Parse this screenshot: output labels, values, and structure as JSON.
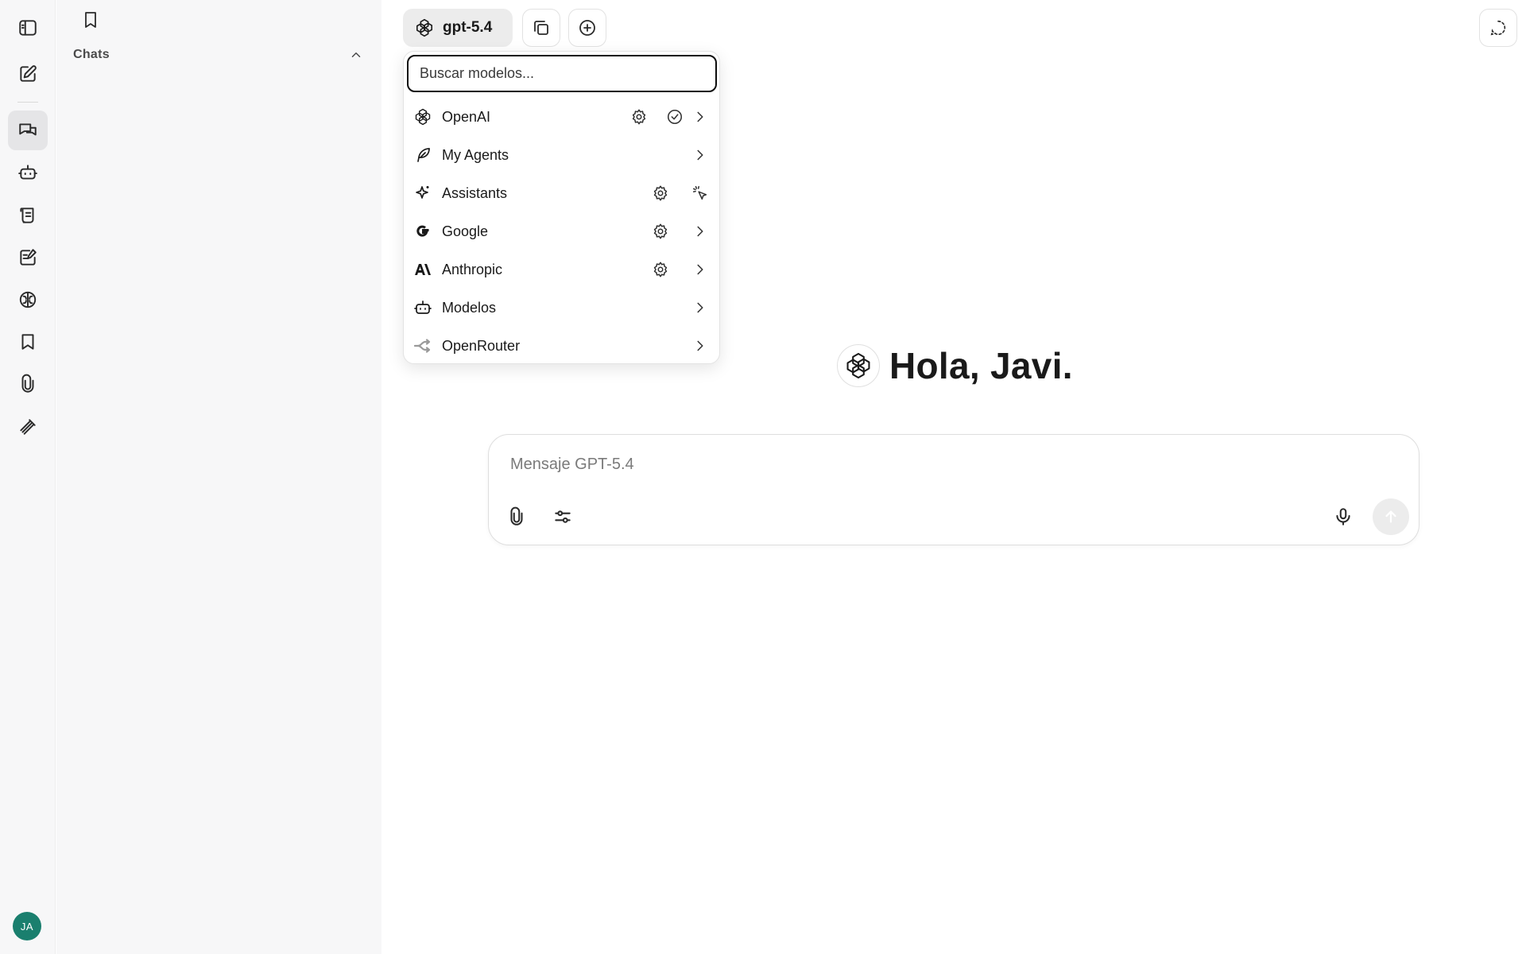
{
  "sidebar": {
    "section_title": "Chats",
    "avatar_initials": "JA"
  },
  "rail": {
    "items": [
      {
        "icon": "sidebar-toggle-icon"
      },
      {
        "icon": "new-chat-icon"
      },
      {
        "icon": "chats-icon",
        "active": true
      },
      {
        "icon": "agents-bot-icon"
      },
      {
        "icon": "prompts-icon"
      },
      {
        "icon": "memories-icon"
      },
      {
        "icon": "brain-icon"
      },
      {
        "icon": "bookmark-icon"
      },
      {
        "icon": "attachments-icon"
      },
      {
        "icon": "tools-icon"
      }
    ]
  },
  "header": {
    "model_label": "gpt-5.4"
  },
  "model_menu": {
    "search_placeholder": "Buscar modelos...",
    "items": [
      {
        "label": "OpenAI",
        "icon": "openai-icon",
        "actions": [
          "settings-icon",
          "check-circle-icon",
          "chevron-right-icon"
        ]
      },
      {
        "label": "My Agents",
        "icon": "feather-icon",
        "actions": [
          "chevron-right-icon"
        ]
      },
      {
        "label": "Assistants",
        "icon": "sparkle-icon",
        "actions": [
          "settings-icon",
          "pointer-click-icon"
        ]
      },
      {
        "label": "Google",
        "icon": "google-icon",
        "actions": [
          "settings-icon",
          "chevron-right-icon"
        ]
      },
      {
        "label": "Anthropic",
        "icon": "anthropic-icon",
        "actions": [
          "settings-icon",
          "chevron-right-icon"
        ]
      },
      {
        "label": "Modelos",
        "icon": "bot-icon",
        "actions": [
          "chevron-right-icon"
        ]
      },
      {
        "label": "OpenRouter",
        "icon": "openrouter-icon",
        "actions": [
          "chevron-right-icon"
        ]
      }
    ]
  },
  "main": {
    "greeting": "Hola, Javi."
  },
  "composer": {
    "placeholder": "Mensaje GPT-5.4"
  },
  "colors": {
    "avatar": "#1a7f6e",
    "sidebar_bg": "#f7f7f8",
    "active_item_bg": "#e5e5e7"
  }
}
